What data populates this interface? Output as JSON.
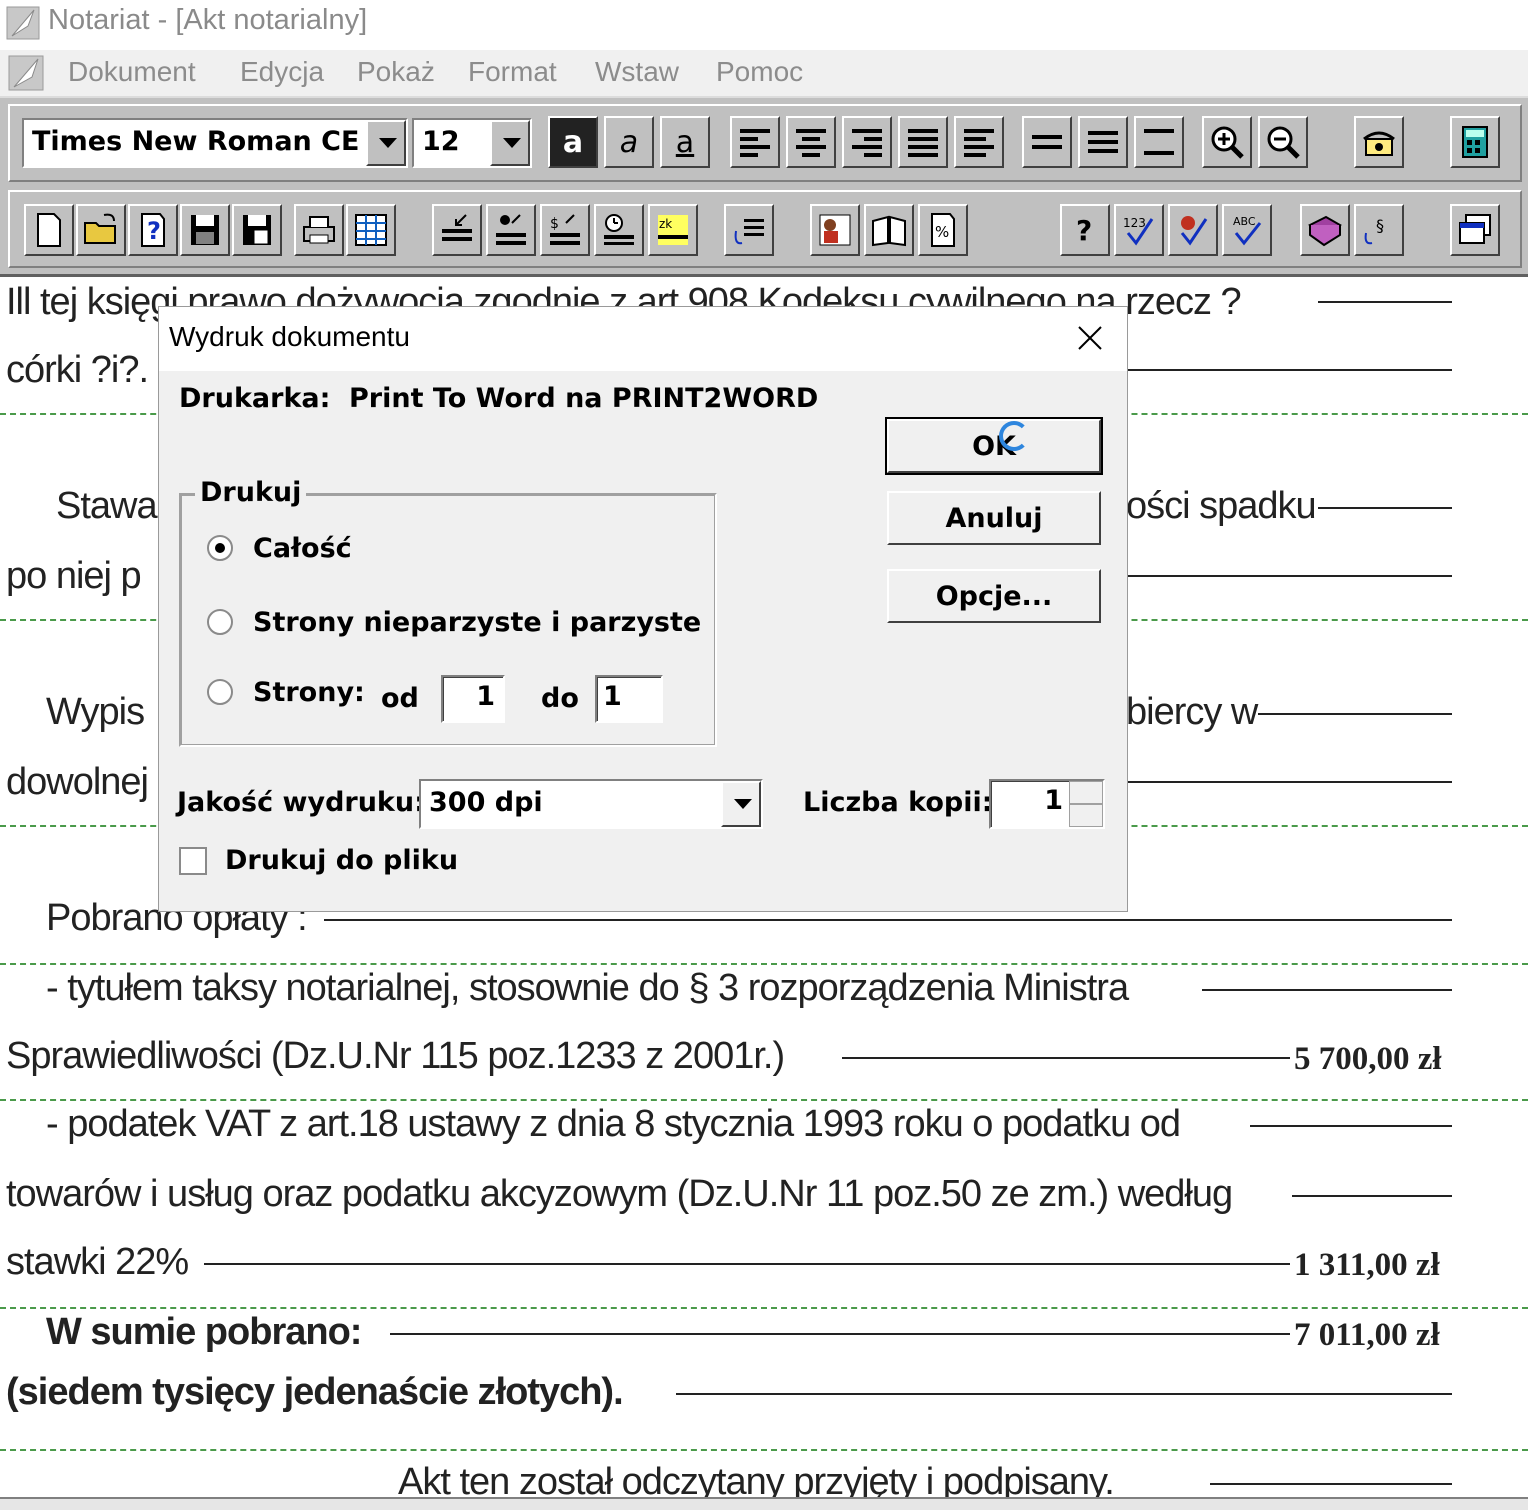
{
  "window": {
    "title": "Notariat - [Akt notarialny]"
  },
  "menu": [
    "Dokument",
    "Edycja",
    "Pokaż",
    "Format",
    "Wstaw",
    "Pomoc"
  ],
  "toolbar": {
    "font_name": "Times New Roman CE",
    "font_size": "12",
    "bold_label": "a",
    "italic_label": "a",
    "underline_label": "a"
  },
  "document": {
    "lines": [
      "Ill tej księgi prawo dożywocia zgodnie z art.908 Kodeksu cywilnego na rzecz ?",
      "córki ?i?.",
      "Stawa",
      "ości spadku",
      "po niej p",
      "Wypis",
      "biercy w",
      "dowolnej",
      "Pobrano opłaty :",
      "- tytułem taksy notarialnej, stosownie do § 3  rozporządzenia Ministra",
      "Sprawiedliwości (Dz.U.Nr 115 poz.1233 z 2001r.)",
      "- podatek VAT z art.18 ustawy z dnia 8 stycznia 1993 roku o podatku od",
      "towarów i usług oraz podatku akcyzowym (Dz.U.Nr 11 poz.50 ze zm.) według",
      "stawki 22%",
      "W sumie pobrano:",
      "(siedem tysięcy jedenaście złotych).",
      "Akt ten został odczytany przyjęty i podpisany."
    ],
    "amounts": [
      "5 700,00 zł",
      "1 311,00 zł",
      "7 011,00 zł"
    ]
  },
  "dialog": {
    "title": "Wydruk dokumentu",
    "printer_label": "Drukarka:",
    "printer_value": "Print To Word na PRINT2WORD",
    "group_label": "Drukuj",
    "radio_all": "Całość",
    "radio_odd_even": "Strony nieparzyste i parzyste",
    "radio_pages": "Strony:",
    "from_label": "od",
    "from_value": "1",
    "to_label": "do",
    "to_value": "1",
    "quality_label": "Jakość wydruku:",
    "quality_value": "300 dpi",
    "copies_label": "Liczba kopii:",
    "copies_value": "1",
    "print_to_file_label": "Drukuj do pliku",
    "ok_label": "OK",
    "cancel_label": "Anuluj",
    "options_label": "Opcje..."
  }
}
